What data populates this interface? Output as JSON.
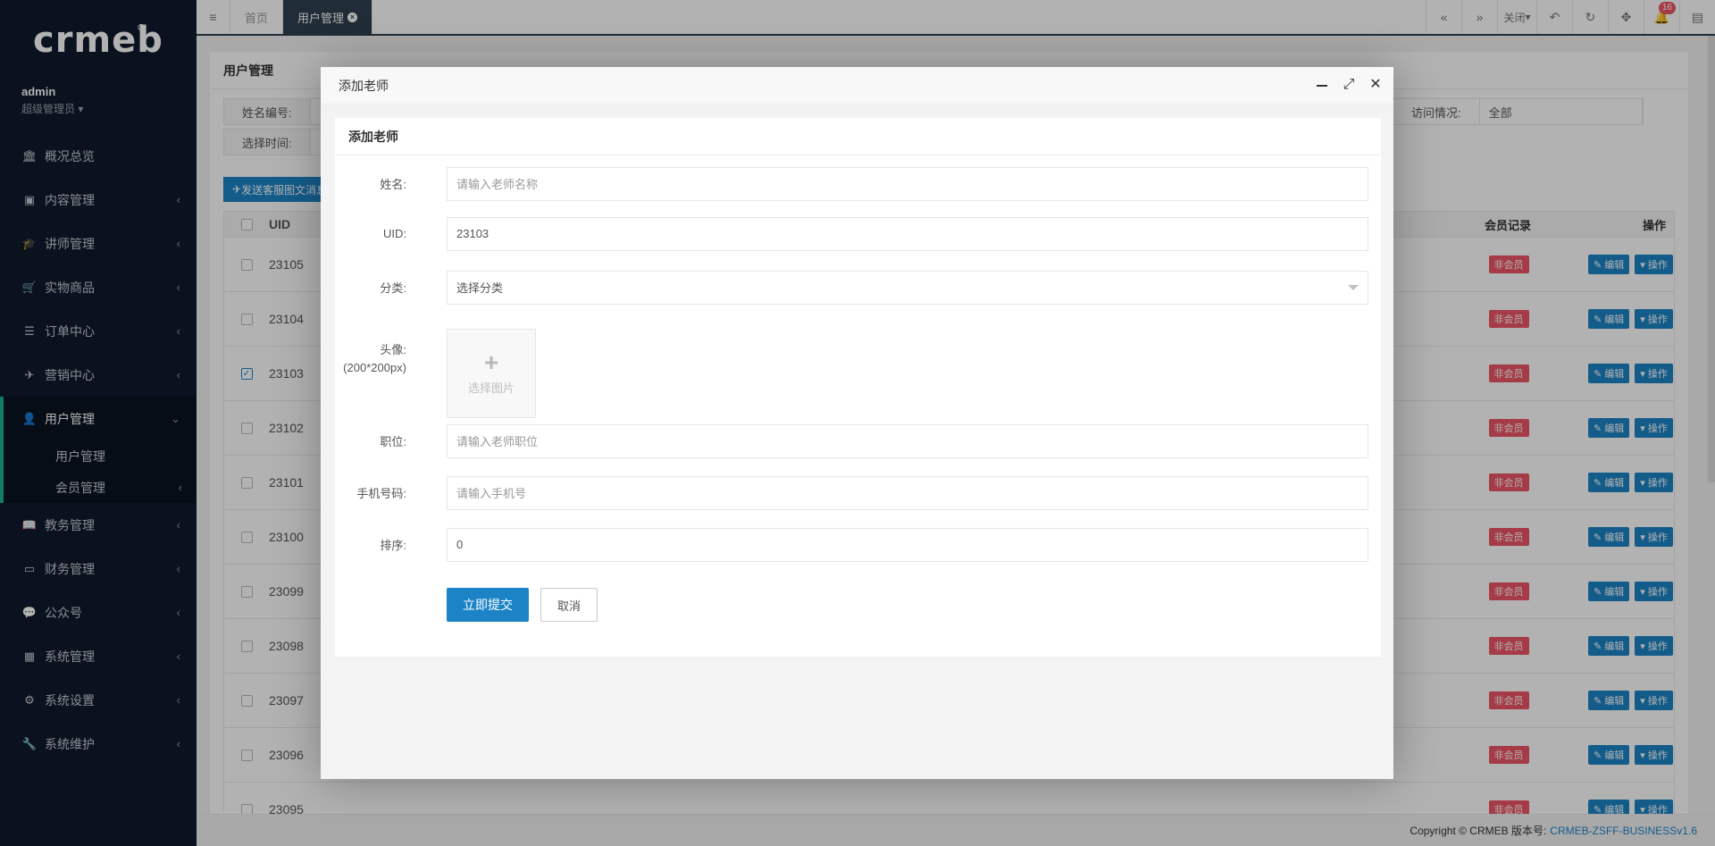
{
  "brand": {
    "logo": "crmeb"
  },
  "profile": {
    "name": "admin",
    "role": "超级管理员"
  },
  "nav": [
    {
      "label": "概况总览",
      "icon": "bank-icon"
    },
    {
      "label": "内容管理",
      "icon": "newspaper-icon"
    },
    {
      "label": "讲师管理",
      "icon": "graduation-cap-icon"
    },
    {
      "label": "实物商品",
      "icon": "cart-icon"
    },
    {
      "label": "订单中心",
      "icon": "list-icon"
    },
    {
      "label": "营销中心",
      "icon": "paper-plane-icon"
    },
    {
      "label": "用户管理",
      "icon": "user-icon"
    },
    {
      "label": "教务管理",
      "icon": "book-icon"
    },
    {
      "label": "财务管理",
      "icon": "money-icon"
    },
    {
      "label": "公众号",
      "icon": "wechat-icon"
    },
    {
      "label": "系统管理",
      "icon": "grid-icon"
    },
    {
      "label": "系统设置",
      "icon": "gear-icon"
    },
    {
      "label": "系统维护",
      "icon": "wrench-icon"
    }
  ],
  "subnav": [
    {
      "label": "用户管理"
    },
    {
      "label": "会员管理"
    }
  ],
  "topbar": {
    "home_tab": "首页",
    "active_tab": "用户管理",
    "close_label": "关闭",
    "notif_count": "16"
  },
  "page": {
    "title": "用户管理",
    "filters": {
      "name_label": "姓名编号:",
      "time_label": "选择时间:",
      "visit_label": "访问情况:",
      "visit_value": "全部"
    },
    "send_button": "发送客服图文消息",
    "table": {
      "col_uid": "UID",
      "col_member": "会员记录",
      "col_ops": "操作",
      "rows": [
        {
          "uid": "23105",
          "checked": false
        },
        {
          "uid": "23104",
          "checked": false
        },
        {
          "uid": "23103",
          "checked": true
        },
        {
          "uid": "23102",
          "checked": false
        },
        {
          "uid": "23101",
          "checked": false
        },
        {
          "uid": "23100",
          "checked": false
        },
        {
          "uid": "23099",
          "checked": false
        },
        {
          "uid": "23098",
          "checked": false
        },
        {
          "uid": "23097",
          "checked": false
        },
        {
          "uid": "23096",
          "checked": false
        },
        {
          "uid": "23095",
          "checked": false
        }
      ],
      "member_tag": "非会员",
      "edit_label": "编辑",
      "op_label": "操作"
    }
  },
  "footer": {
    "copyright": "Copyright © CRMEB 版本号:",
    "version": "CRMEB-ZSFF-BUSINESSv1.6"
  },
  "modal": {
    "title": "添加老师",
    "card_title": "添加老师",
    "fields": {
      "name_label": "姓名:",
      "name_placeholder": "请输入老师名称",
      "uid_label": "UID:",
      "uid_value": "23103",
      "category_label": "分类:",
      "category_placeholder": "选择分类",
      "avatar_label": "头像:",
      "avatar_hint": "(200*200px)",
      "avatar_button": "选择图片",
      "position_label": "职位:",
      "position_placeholder": "请输入老师职位",
      "phone_label": "手机号码:",
      "phone_placeholder": "请输入手机号",
      "sort_label": "排序:",
      "sort_value": "0"
    },
    "submit_label": "立即提交",
    "cancel_label": "取消"
  }
}
